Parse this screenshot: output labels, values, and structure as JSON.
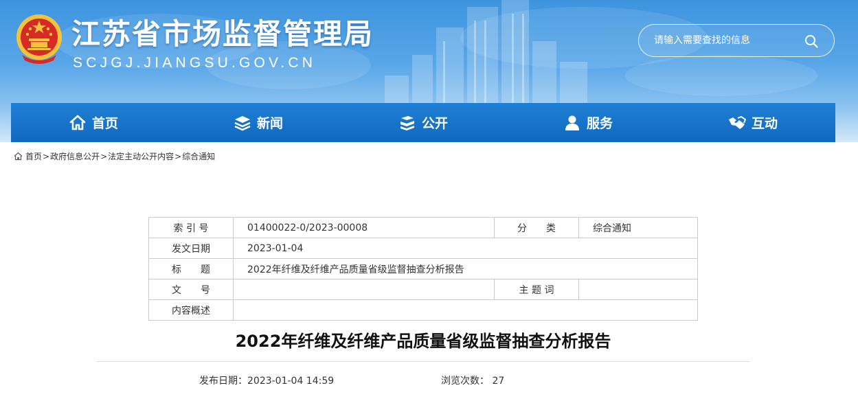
{
  "header": {
    "title": "江苏省市场监督管理局",
    "domain": "SCJGJ.JIANGSU.GOV.CN",
    "search_placeholder": "请输入需要查找的信息"
  },
  "nav": [
    {
      "label": "首页",
      "icon": "home-icon"
    },
    {
      "label": "新闻",
      "icon": "layers-icon"
    },
    {
      "label": "公开",
      "icon": "books-icon"
    },
    {
      "label": "服务",
      "icon": "user-service-icon"
    },
    {
      "label": "互动",
      "icon": "handshake-icon"
    }
  ],
  "breadcrumb": {
    "items": [
      "首页",
      "政府信息公开",
      "法定主动公开内容",
      "综合通知"
    ],
    "separator": ">"
  },
  "meta": {
    "index_label": "索 引 号",
    "index_value": "01400022-0/2023-00008",
    "category_label": "分　　类",
    "category_value": "综合通知",
    "date_label": "发文日期",
    "date_value": "2023-01-04",
    "title_label": "标　　题",
    "title_value": "2022年纤维及纤维产品质量省级监督抽查分析报告",
    "docno_label": "文　　号",
    "docno_value": "",
    "keywords_label": "主 题 词",
    "keywords_value": "",
    "summary_label": "内容概述",
    "summary_value": ""
  },
  "article": {
    "title": "2022年纤维及纤维产品质量省级监督抽查分析报告",
    "publish_date": "发布日期：2023-01-04 14:59",
    "views": "浏览次数：  27"
  },
  "colors": {
    "nav_blue": "#1a74c9",
    "banner_blue": "#3d94de"
  }
}
